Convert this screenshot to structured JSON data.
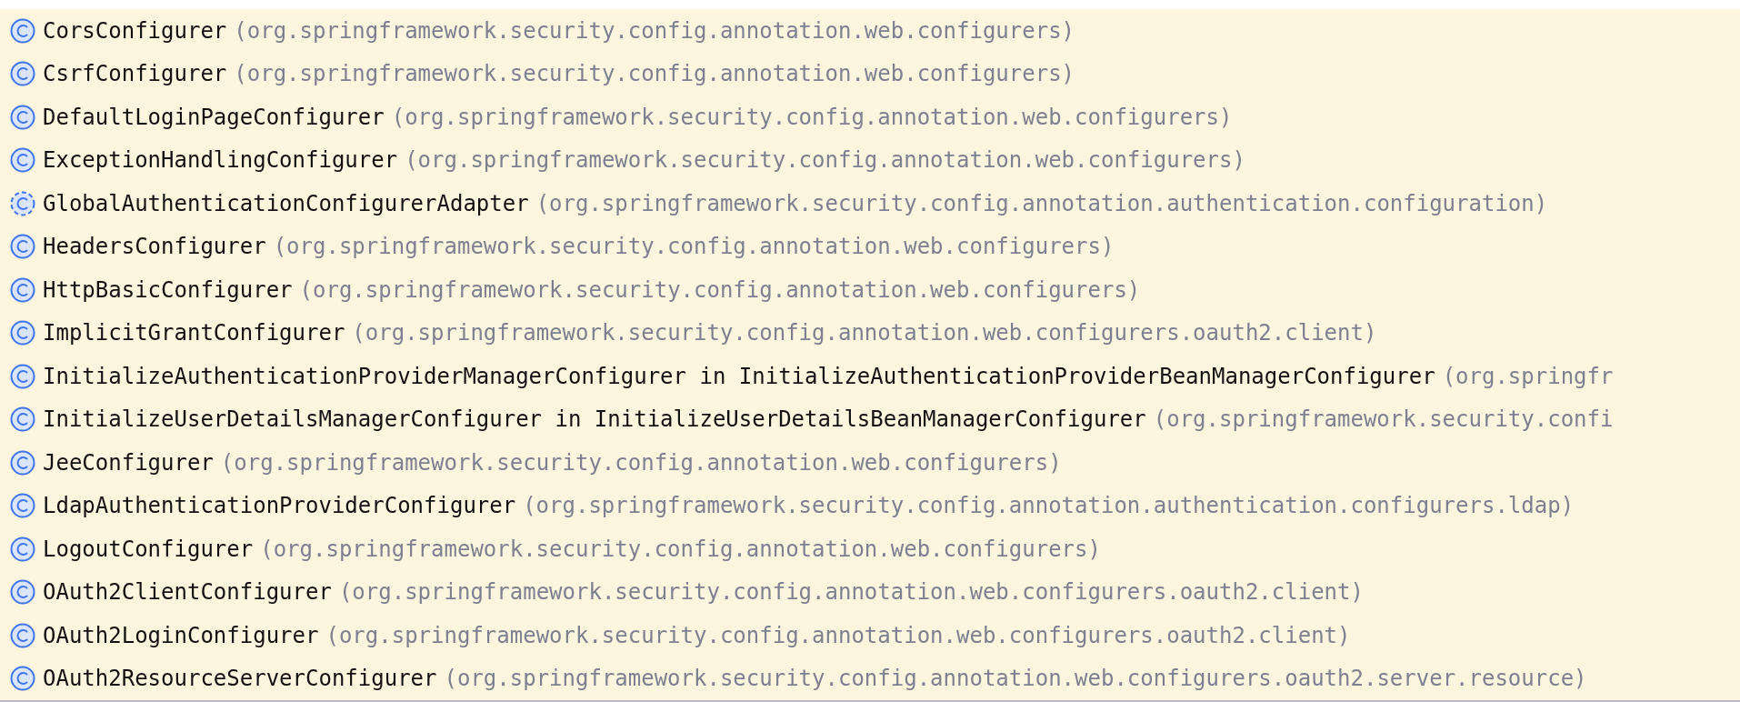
{
  "items": [
    {
      "kind": "class",
      "name": "CorsConfigurer",
      "package": "(org.springframework.security.config.annotation.web.configurers)"
    },
    {
      "kind": "class",
      "name": "CsrfConfigurer",
      "package": "(org.springframework.security.config.annotation.web.configurers)"
    },
    {
      "kind": "class",
      "name": "DefaultLoginPageConfigurer",
      "package": "(org.springframework.security.config.annotation.web.configurers)"
    },
    {
      "kind": "class",
      "name": "ExceptionHandlingConfigurer",
      "package": "(org.springframework.security.config.annotation.web.configurers)"
    },
    {
      "kind": "abstract",
      "name": "GlobalAuthenticationConfigurerAdapter",
      "package": "(org.springframework.security.config.annotation.authentication.configuration)"
    },
    {
      "kind": "class",
      "name": "HeadersConfigurer",
      "package": "(org.springframework.security.config.annotation.web.configurers)"
    },
    {
      "kind": "class",
      "name": "HttpBasicConfigurer",
      "package": "(org.springframework.security.config.annotation.web.configurers)"
    },
    {
      "kind": "class",
      "name": "ImplicitGrantConfigurer",
      "package": "(org.springframework.security.config.annotation.web.configurers.oauth2.client)"
    },
    {
      "kind": "class",
      "name": "InitializeAuthenticationProviderManagerConfigurer in InitializeAuthenticationProviderBeanManagerConfigurer",
      "package": "(org.springfr"
    },
    {
      "kind": "class",
      "name": "InitializeUserDetailsManagerConfigurer in InitializeUserDetailsBeanManagerConfigurer",
      "package": "(org.springframework.security.confi"
    },
    {
      "kind": "class",
      "name": "JeeConfigurer",
      "package": "(org.springframework.security.config.annotation.web.configurers)"
    },
    {
      "kind": "class",
      "name": "LdapAuthenticationProviderConfigurer",
      "package": "(org.springframework.security.config.annotation.authentication.configurers.ldap)"
    },
    {
      "kind": "class",
      "name": "LogoutConfigurer",
      "package": "(org.springframework.security.config.annotation.web.configurers)"
    },
    {
      "kind": "class",
      "name": "OAuth2ClientConfigurer",
      "package": "(org.springframework.security.config.annotation.web.configurers.oauth2.client)"
    },
    {
      "kind": "class",
      "name": "OAuth2LoginConfigurer",
      "package": "(org.springframework.security.config.annotation.web.configurers.oauth2.client)"
    },
    {
      "kind": "class",
      "name": "OAuth2ResourceServerConfigurer",
      "package": "(org.springframework.security.config.annotation.web.configurers.oauth2.server.resource)"
    }
  ]
}
